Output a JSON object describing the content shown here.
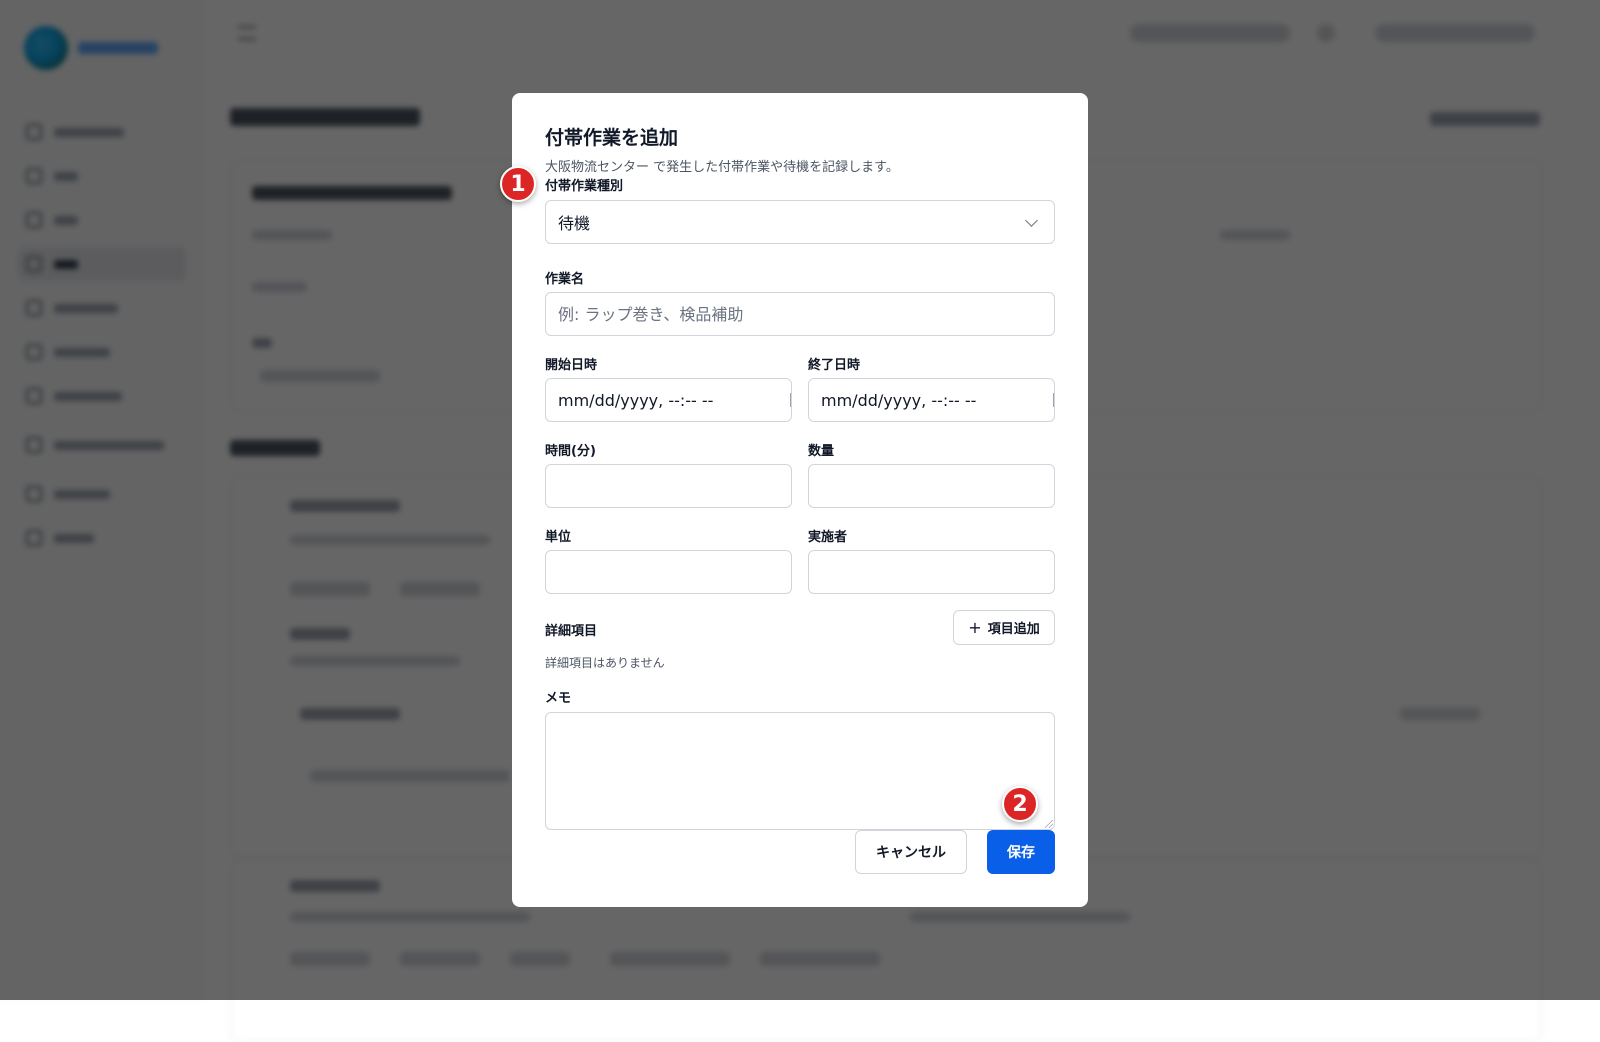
{
  "modal": {
    "title": "付帯作業を追加",
    "subtitle": "大阪物流センター で発生した付帯作業や待機を記録します。",
    "fields": {
      "work_type": {
        "label": "付帯作業種別",
        "value": "待機"
      },
      "work_name": {
        "label": "作業名",
        "placeholder": "例: ラップ巻き、検品補助",
        "value": ""
      },
      "start_datetime": {
        "label": "開始日時",
        "value": "mm/dd/yyyy, --:-- --"
      },
      "end_datetime": {
        "label": "終了日時",
        "value": "mm/dd/yyyy, --:-- --"
      },
      "duration_min": {
        "label": "時間(分)",
        "value": ""
      },
      "quantity": {
        "label": "数量",
        "value": ""
      },
      "unit": {
        "label": "単位",
        "value": ""
      },
      "performer": {
        "label": "実施者",
        "value": ""
      },
      "memo": {
        "label": "メモ",
        "value": ""
      }
    },
    "details": {
      "label": "詳細項目",
      "add_button": "項目追加",
      "empty_text": "詳細項目はありません"
    },
    "actions": {
      "cancel": "キャンセル",
      "save": "保存"
    }
  },
  "annotations": {
    "badge_1": "1",
    "badge_2": "2"
  },
  "colors": {
    "primary": "#0a5fe8",
    "badge": "#dc2626",
    "overlay": "rgba(0,0,0,0.6)"
  }
}
